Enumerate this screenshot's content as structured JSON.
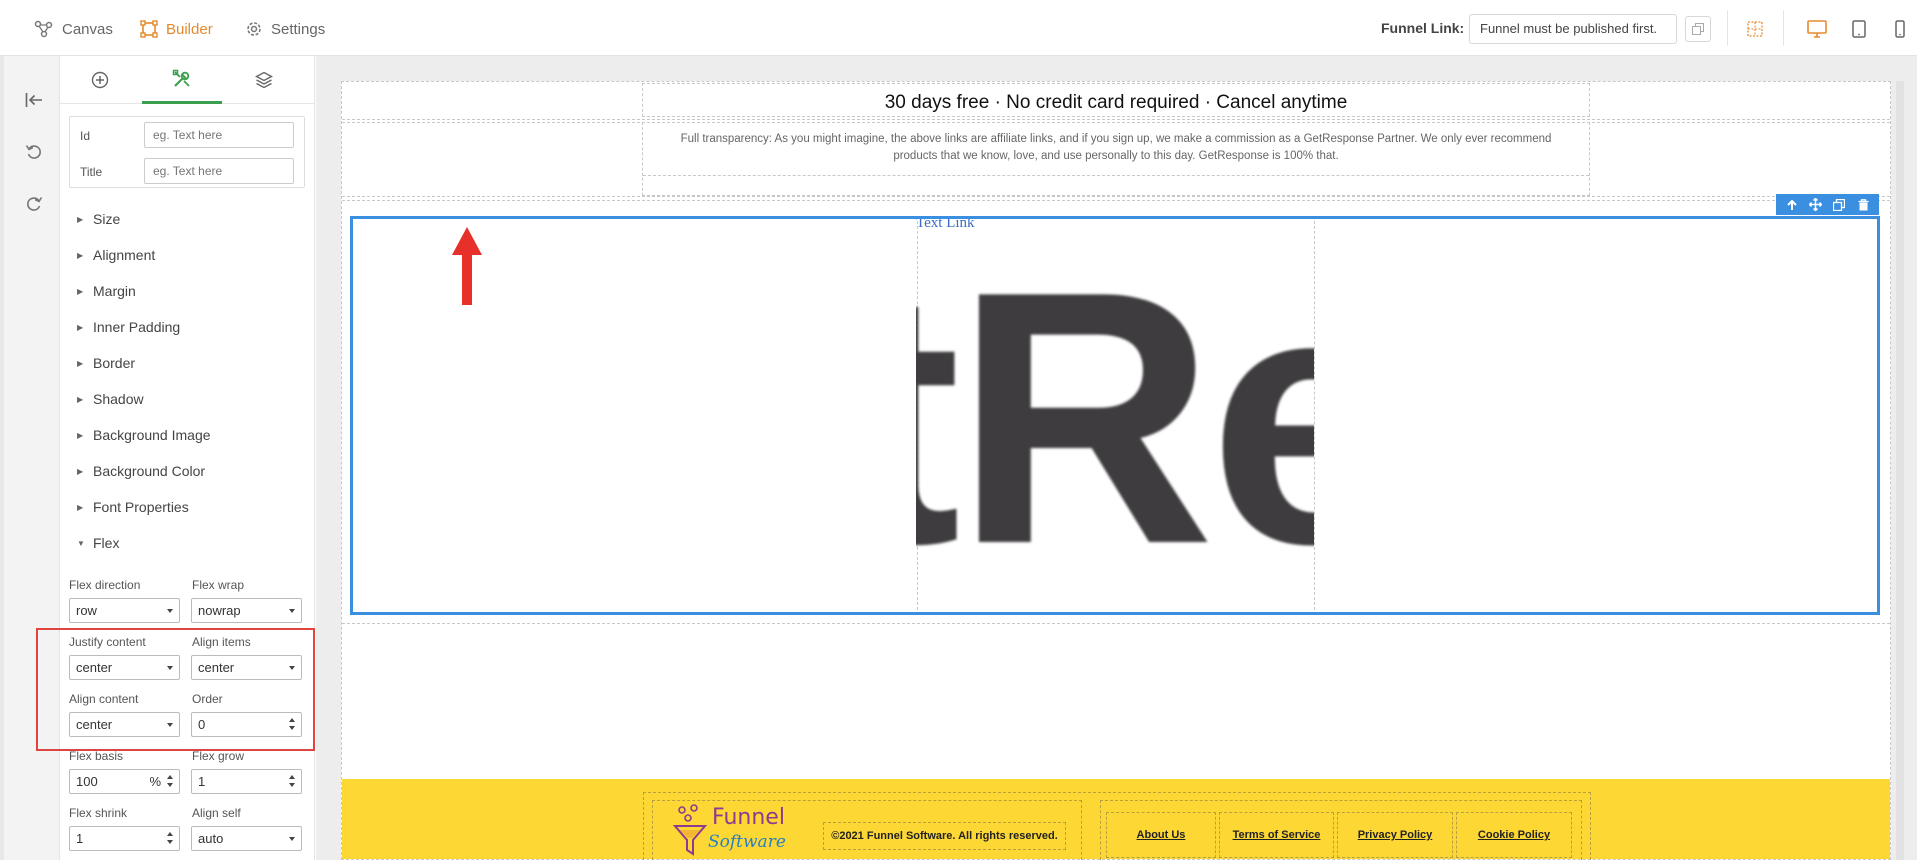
{
  "topbar": {
    "nav": [
      {
        "label": "Canvas",
        "icon": "canvas-icon"
      },
      {
        "label": "Builder",
        "icon": "builder-icon"
      },
      {
        "label": "Settings",
        "icon": "gear-icon"
      }
    ],
    "funnel_link_label": "Funnel Link:",
    "funnel_link_value": "Funnel must be published first.",
    "accent_color": "#e58a2c"
  },
  "panel": {
    "tabs": [
      "add-icon",
      "style-tools-icon",
      "layers-icon"
    ],
    "attributes": {
      "id_label": "Id",
      "id_placeholder": "eg. Text here",
      "title_label": "Title",
      "title_placeholder": "eg. Text here"
    },
    "sections": [
      "Size",
      "Alignment",
      "Margin",
      "Inner Padding",
      "Border",
      "Shadow",
      "Background Image",
      "Background Color",
      "Font Properties",
      "Flex"
    ],
    "flex": {
      "direction_label": "Flex direction",
      "direction_value": "row",
      "wrap_label": "Flex wrap",
      "wrap_value": "nowrap",
      "justify_label": "Justify content",
      "justify_value": "center",
      "align_items_label": "Align items",
      "align_items_value": "center",
      "align_content_label": "Align content",
      "align_content_value": "center",
      "order_label": "Order",
      "order_value": "0",
      "basis_label": "Flex basis",
      "basis_value": "100",
      "basis_unit": "%",
      "grow_label": "Flex grow",
      "grow_value": "1",
      "shrink_label": "Flex shrink",
      "shrink_value": "1",
      "align_self_label": "Align self",
      "align_self_value": "auto"
    }
  },
  "canvas": {
    "hero_text": "30 days free · No credit card required · Cancel anytime",
    "disclaimer": "Full transparency: As you might imagine, the above links are affiliate links, and if you sign up, we make a commission as a GetResponse Partner. We only ever recommend products that we know, love, and use personally to this day. GetResponse is 100% that.",
    "text_link": "Text Link",
    "logo_fragment": "tRe",
    "footer": {
      "brand_top": "Funnel",
      "brand_bottom": "Software",
      "copyright": "©2021 Funnel Software. All rights reserved.",
      "links": [
        "About Us",
        "Terms of Service",
        "Privacy Policy",
        "Cookie Policy"
      ],
      "background": "#fdd835"
    },
    "selection_color": "#3a8fe0"
  }
}
